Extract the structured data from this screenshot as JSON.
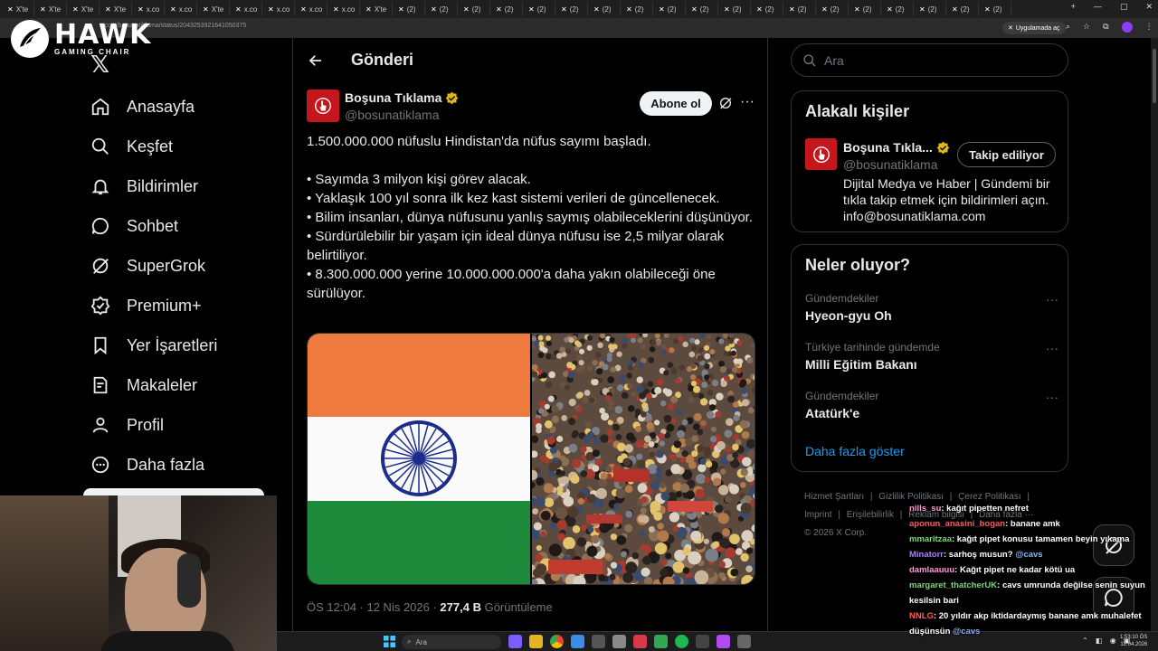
{
  "browser": {
    "tabs": [
      "X'te",
      "X'te",
      "X'te",
      "X'te",
      "x.co",
      "x.co",
      "X'te",
      "x.co",
      "x.co",
      "x.co",
      "x.co",
      "X'te",
      "(2)",
      "(2)",
      "(2)",
      "(2)",
      "(2)",
      "(2)",
      "(2)",
      "(2)",
      "(2)",
      "(2)",
      "(2)",
      "(2)",
      "(2)",
      "(2)",
      "(2)",
      "(2)",
      "(2)",
      "(2)",
      "(2)"
    ],
    "url": "x.com/bosunatiklama/status/2043253921641050375",
    "open_in_app": "Uygulamada aç"
  },
  "overlay": {
    "brand_title": "HAWK",
    "brand_sub": "GAMING CHAIR"
  },
  "nav": {
    "items": [
      {
        "label": "Anasayfa",
        "icon": "home-icon"
      },
      {
        "label": "Keşfet",
        "icon": "search-icon"
      },
      {
        "label": "Bildirimler",
        "icon": "bell-icon"
      },
      {
        "label": "Sohbet",
        "icon": "chat-icon"
      },
      {
        "label": "SuperGrok",
        "icon": "grok-icon"
      },
      {
        "label": "Premium+",
        "icon": "premium-icon"
      },
      {
        "label": "Yer İşaretleri",
        "icon": "bookmark-icon"
      },
      {
        "label": "Makaleler",
        "icon": "article-icon"
      },
      {
        "label": "Profil",
        "icon": "profile-icon"
      },
      {
        "label": "Daha fazla",
        "icon": "more-icon"
      }
    ]
  },
  "main": {
    "title": "Gönderi",
    "post": {
      "author_name": "Boşuna Tıklama",
      "author_handle": "@bosunatiklama",
      "subscribe_label": "Abone ol",
      "text_intro": "1.500.000.000 nüfuslu Hindistan'da nüfus sayımı başladı.",
      "bullets": [
        "• Sayımda 3 milyon kişi görev alacak.",
        "• Yaklaşık 100 yıl sonra ilk kez kast sistemi verileri de güncellenecek.",
        "• Bilim insanları, dünya nüfusunu yanlış saymış olabileceklerini düşünüyor.",
        "• Sürdürülebilir bir yaşam için ideal dünya nüfusu ise 2,5 milyar olarak belirtiliyor.",
        "• 8.300.000.000 yerine 10.000.000.000'a daha yakın olabileceği öne sürülüyor."
      ],
      "timestamp": "ÖS 12:04 · 12 Nis 2026 · ",
      "views": "277,4 B",
      "views_label": " Görüntüleme"
    }
  },
  "sidebar": {
    "search_placeholder": "Ara",
    "related": {
      "title": "Alakalı kişiler",
      "name": "Boşuna Tıkla...",
      "handle": "@bosunatiklama",
      "follow_label": "Takip ediliyor",
      "bio": "Dijital Medya ve Haber | Gündemi bir tıkla takip etmek için bildirimleri açın. info@bosunatiklama.com"
    },
    "trends": {
      "title": "Neler oluyor?",
      "items": [
        {
          "category": "Gündemdekiler",
          "name": "Hyeon-gyu Oh"
        },
        {
          "category": "Türkiye tarihinde gündemde",
          "name": "Milli Eğitim Bakanı"
        },
        {
          "category": "Gündemdekiler",
          "name": "Atatürk'e"
        }
      ],
      "show_more": "Daha fazla göster"
    },
    "footer": [
      "Hizmet Şartları",
      "|",
      "Gizlilik Politikası",
      "|",
      "Çerez Politikası",
      "|",
      "Imprint",
      "|",
      "Erişilebilirlik",
      "|",
      "Reklam bilgisi",
      "|",
      "Daha fazla ···",
      "© 2026 X Corp."
    ]
  },
  "chat": {
    "messages": [
      {
        "user": "nills_su",
        "text": ": kağıt pipetten nefret",
        "color": "#ff9ad5"
      },
      {
        "user": "aponun_anasini_bogan",
        "text": ": banane amk",
        "color": "#ff5b5b"
      },
      {
        "user": "mmaritzaa",
        "text": ": kağıt pipet konusu tamamen beyin yıkama",
        "color": "#7cd67c"
      },
      {
        "user": "Minatorr",
        "text": ": sarhoş musun? ",
        "mention": "@cavs",
        "color": "#b07cff"
      },
      {
        "user": "damlaauuu",
        "text": ": Kağıt pipet ne kadar kötü ua",
        "color": "#ff9ad5"
      },
      {
        "user": "margaret_thatcherUK",
        "text": ": cavs umrunda değilse senin suyun kesilsin bari",
        "color": "#7cd67c"
      },
      {
        "user": "NNLG",
        "text": ": 20 yıldır akp iktidardaymış banane amk muhalefet düşünsün ",
        "mention": "@cavs",
        "color": "#ff5b5b"
      }
    ]
  },
  "taskbar": {
    "search_placeholder": "Ara",
    "time": "1:53:10 ÖS",
    "date": "12.04.2026"
  },
  "colors": {
    "accent": "#1d9bf0",
    "brand_red": "#c4161c",
    "verified": "#e2b719"
  }
}
